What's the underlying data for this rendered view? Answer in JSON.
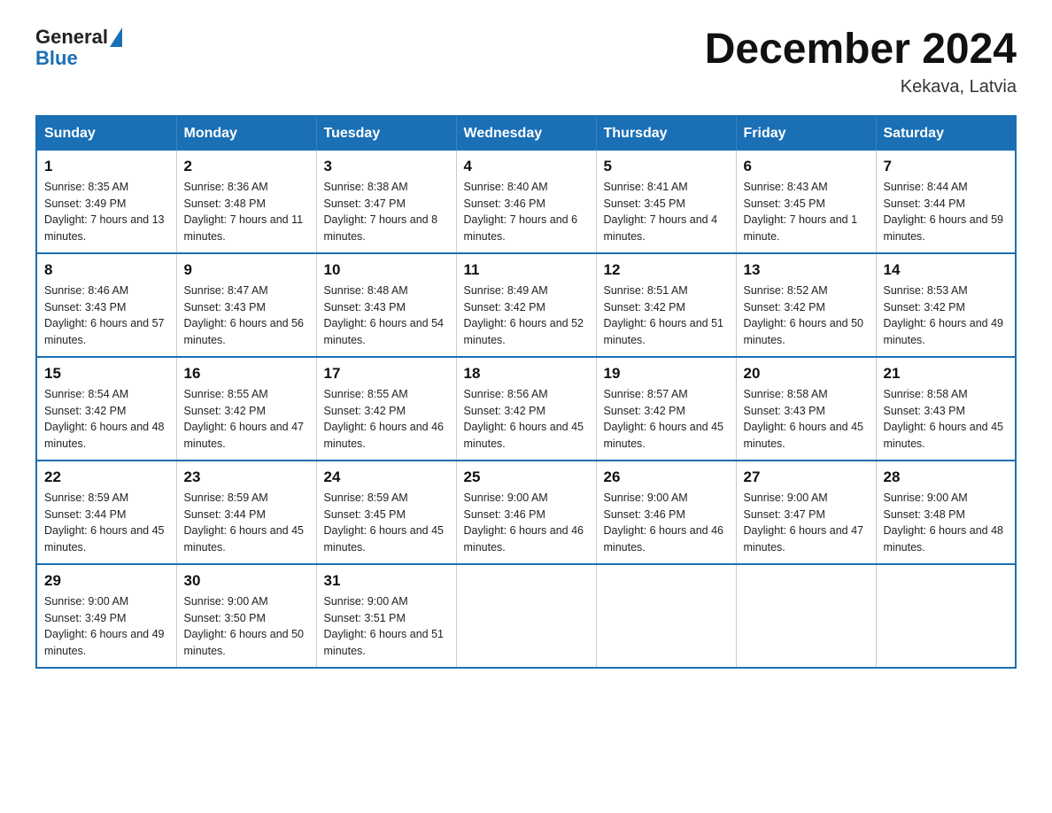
{
  "header": {
    "logo_general": "General",
    "logo_blue": "Blue",
    "month_title": "December 2024",
    "location": "Kekava, Latvia"
  },
  "weekdays": [
    "Sunday",
    "Monday",
    "Tuesday",
    "Wednesday",
    "Thursday",
    "Friday",
    "Saturday"
  ],
  "weeks": [
    [
      {
        "day": "1",
        "sunrise": "8:35 AM",
        "sunset": "3:49 PM",
        "daylight": "7 hours and 13 minutes."
      },
      {
        "day": "2",
        "sunrise": "8:36 AM",
        "sunset": "3:48 PM",
        "daylight": "7 hours and 11 minutes."
      },
      {
        "day": "3",
        "sunrise": "8:38 AM",
        "sunset": "3:47 PM",
        "daylight": "7 hours and 8 minutes."
      },
      {
        "day": "4",
        "sunrise": "8:40 AM",
        "sunset": "3:46 PM",
        "daylight": "7 hours and 6 minutes."
      },
      {
        "day": "5",
        "sunrise": "8:41 AM",
        "sunset": "3:45 PM",
        "daylight": "7 hours and 4 minutes."
      },
      {
        "day": "6",
        "sunrise": "8:43 AM",
        "sunset": "3:45 PM",
        "daylight": "7 hours and 1 minute."
      },
      {
        "day": "7",
        "sunrise": "8:44 AM",
        "sunset": "3:44 PM",
        "daylight": "6 hours and 59 minutes."
      }
    ],
    [
      {
        "day": "8",
        "sunrise": "8:46 AM",
        "sunset": "3:43 PM",
        "daylight": "6 hours and 57 minutes."
      },
      {
        "day": "9",
        "sunrise": "8:47 AM",
        "sunset": "3:43 PM",
        "daylight": "6 hours and 56 minutes."
      },
      {
        "day": "10",
        "sunrise": "8:48 AM",
        "sunset": "3:43 PM",
        "daylight": "6 hours and 54 minutes."
      },
      {
        "day": "11",
        "sunrise": "8:49 AM",
        "sunset": "3:42 PM",
        "daylight": "6 hours and 52 minutes."
      },
      {
        "day": "12",
        "sunrise": "8:51 AM",
        "sunset": "3:42 PM",
        "daylight": "6 hours and 51 minutes."
      },
      {
        "day": "13",
        "sunrise": "8:52 AM",
        "sunset": "3:42 PM",
        "daylight": "6 hours and 50 minutes."
      },
      {
        "day": "14",
        "sunrise": "8:53 AM",
        "sunset": "3:42 PM",
        "daylight": "6 hours and 49 minutes."
      }
    ],
    [
      {
        "day": "15",
        "sunrise": "8:54 AM",
        "sunset": "3:42 PM",
        "daylight": "6 hours and 48 minutes."
      },
      {
        "day": "16",
        "sunrise": "8:55 AM",
        "sunset": "3:42 PM",
        "daylight": "6 hours and 47 minutes."
      },
      {
        "day": "17",
        "sunrise": "8:55 AM",
        "sunset": "3:42 PM",
        "daylight": "6 hours and 46 minutes."
      },
      {
        "day": "18",
        "sunrise": "8:56 AM",
        "sunset": "3:42 PM",
        "daylight": "6 hours and 45 minutes."
      },
      {
        "day": "19",
        "sunrise": "8:57 AM",
        "sunset": "3:42 PM",
        "daylight": "6 hours and 45 minutes."
      },
      {
        "day": "20",
        "sunrise": "8:58 AM",
        "sunset": "3:43 PM",
        "daylight": "6 hours and 45 minutes."
      },
      {
        "day": "21",
        "sunrise": "8:58 AM",
        "sunset": "3:43 PM",
        "daylight": "6 hours and 45 minutes."
      }
    ],
    [
      {
        "day": "22",
        "sunrise": "8:59 AM",
        "sunset": "3:44 PM",
        "daylight": "6 hours and 45 minutes."
      },
      {
        "day": "23",
        "sunrise": "8:59 AM",
        "sunset": "3:44 PM",
        "daylight": "6 hours and 45 minutes."
      },
      {
        "day": "24",
        "sunrise": "8:59 AM",
        "sunset": "3:45 PM",
        "daylight": "6 hours and 45 minutes."
      },
      {
        "day": "25",
        "sunrise": "9:00 AM",
        "sunset": "3:46 PM",
        "daylight": "6 hours and 46 minutes."
      },
      {
        "day": "26",
        "sunrise": "9:00 AM",
        "sunset": "3:46 PM",
        "daylight": "6 hours and 46 minutes."
      },
      {
        "day": "27",
        "sunrise": "9:00 AM",
        "sunset": "3:47 PM",
        "daylight": "6 hours and 47 minutes."
      },
      {
        "day": "28",
        "sunrise": "9:00 AM",
        "sunset": "3:48 PM",
        "daylight": "6 hours and 48 minutes."
      }
    ],
    [
      {
        "day": "29",
        "sunrise": "9:00 AM",
        "sunset": "3:49 PM",
        "daylight": "6 hours and 49 minutes."
      },
      {
        "day": "30",
        "sunrise": "9:00 AM",
        "sunset": "3:50 PM",
        "daylight": "6 hours and 50 minutes."
      },
      {
        "day": "31",
        "sunrise": "9:00 AM",
        "sunset": "3:51 PM",
        "daylight": "6 hours and 51 minutes."
      },
      null,
      null,
      null,
      null
    ]
  ]
}
